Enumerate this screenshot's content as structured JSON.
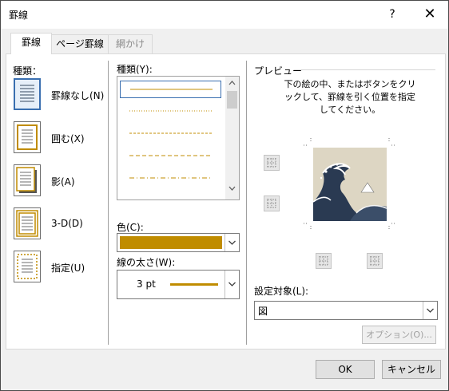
{
  "window": {
    "title": "罫線",
    "help_label": "?",
    "close_label": "✕"
  },
  "tabs": [
    {
      "label": "罫線",
      "state": "active"
    },
    {
      "label": "ページ罫線",
      "state": "normal"
    },
    {
      "label": "網かけ",
      "state": "disabled"
    }
  ],
  "setting": {
    "heading": "種類：",
    "items": [
      {
        "label": "罫線なし(N)",
        "icon": "border-none-icon",
        "selected": true
      },
      {
        "label": "囲む(X)",
        "icon": "border-box-icon",
        "selected": false
      },
      {
        "label": "影(A)",
        "icon": "border-shadow-icon",
        "selected": false
      },
      {
        "label": "3-D(D)",
        "icon": "border-3d-icon",
        "selected": false
      },
      {
        "label": "指定(U)",
        "icon": "border-custom-icon",
        "selected": false
      }
    ]
  },
  "style": {
    "heading": "種類(Y):",
    "selected_index": 0,
    "items": [
      "solid",
      "dotted",
      "dashed",
      "dash-long",
      "dash-dot"
    ]
  },
  "color": {
    "label": "色(C):",
    "value": "#c08c00"
  },
  "width": {
    "label": "線の太さ(W):",
    "value": "3 pt"
  },
  "preview": {
    "heading": "プレビュー",
    "instruction": "下の絵の中、またはボタンをクリックして、罫線を引く位置を指定してください。"
  },
  "apply_to": {
    "label": "設定対象(L):",
    "value": "図"
  },
  "buttons": {
    "options": "オプション(O)...",
    "ok": "OK",
    "cancel": "キャンセル"
  },
  "colors": {
    "accent": "#c08c00",
    "selection": "#3a6fb0"
  }
}
